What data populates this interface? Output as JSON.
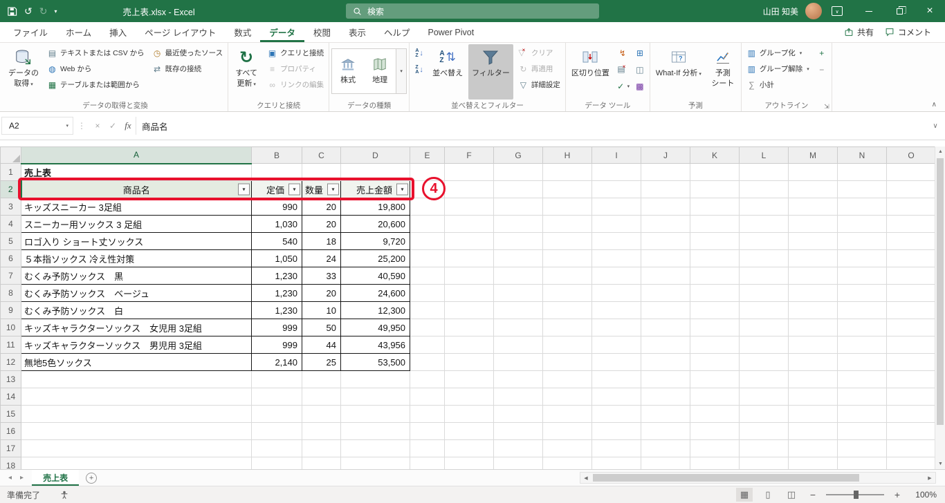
{
  "title_bar": {
    "document_title": "売上表.xlsx - Excel",
    "search_label": "検索",
    "user_name": "山田 知美"
  },
  "tab_row": {
    "tabs": [
      {
        "label": "ファイル",
        "active": false
      },
      {
        "label": "ホーム",
        "active": false
      },
      {
        "label": "挿入",
        "active": false
      },
      {
        "label": "ページ レイアウト",
        "active": false
      },
      {
        "label": "数式",
        "active": false
      },
      {
        "label": "データ",
        "active": true
      },
      {
        "label": "校閲",
        "active": false
      },
      {
        "label": "表示",
        "active": false
      },
      {
        "label": "ヘルプ",
        "active": false
      },
      {
        "label": "Power Pivot",
        "active": false
      }
    ],
    "share": "共有",
    "comments": "コメント"
  },
  "ribbon": {
    "group_labels": [
      "データの取得と変換",
      "クエリと接続",
      "データの種類",
      "並べ替えとフィルター",
      "データ ツール",
      "予測",
      "アウトライン"
    ],
    "get_data_l1": "データの",
    "get_data_l2": "取得",
    "from_text_csv": "テキストまたは CSV から",
    "from_web": "Web から",
    "from_table_range": "テーブルまたは範囲から",
    "recent_sources": "最近使ったソース",
    "existing_connections": "既存の接続",
    "refresh_l1": "すべて",
    "refresh_l2": "更新",
    "queries_connections": "クエリと接続",
    "properties": "プロパティ",
    "edit_links": "リンクの編集",
    "stocks": "株式",
    "geography": "地理",
    "sort": "並べ替え",
    "filter": "フィルター",
    "clear": "クリア",
    "reapply": "再適用",
    "advanced": "詳細設定",
    "text_to_columns": "区切り位置",
    "what_if": "What-If 分析",
    "forecast_l1": "予測",
    "forecast_l2": "シート",
    "group": "グループ化",
    "ungroup": "グループ解除",
    "subtotal": "小計"
  },
  "formula_bar": {
    "name_box": "A2",
    "fx": "fx",
    "value": "商品名"
  },
  "grid": {
    "column_headers": [
      "A",
      "B",
      "C",
      "D",
      "E",
      "F",
      "G",
      "H",
      "I",
      "J",
      "K",
      "L",
      "M",
      "N",
      "O"
    ],
    "row_count": 18,
    "title_cell": "売上表",
    "header_cells": [
      "商品名",
      "定価",
      "数量",
      "売上金額"
    ],
    "data_rows": [
      [
        "キッズスニーカー 3足組",
        "990",
        "20",
        "19,800"
      ],
      [
        "スニーカー用ソックス 3 足組",
        "1,030",
        "20",
        "20,600"
      ],
      [
        "ロゴ入り ショート丈ソックス",
        "540",
        "18",
        "9,720"
      ],
      [
        "５本指ソックス 冷え性対策",
        "1,050",
        "24",
        "25,200"
      ],
      [
        "むくみ予防ソックス　黒",
        "1,230",
        "33",
        "40,590"
      ],
      [
        "むくみ予防ソックス　ベージュ",
        "1,230",
        "20",
        "24,600"
      ],
      [
        "むくみ予防ソックス　白",
        "1,230",
        "10",
        "12,300"
      ],
      [
        "キッズキャラクターソックス　女児用 3足組",
        "999",
        "50",
        "49,950"
      ],
      [
        "キッズキャラクターソックス　男児用 3足組",
        "999",
        "44",
        "43,956"
      ],
      [
        "無地5色ソックス",
        "2,140",
        "25",
        "53,500"
      ]
    ],
    "active_cell": "A2"
  },
  "annotation": {
    "label": "4"
  },
  "sheet_tabs": {
    "active_tab": "売上表"
  },
  "status_bar": {
    "ready": "準備完了",
    "zoom": "100%"
  },
  "colors": {
    "brand_green": "#217346",
    "annotation_red": "#E8112D"
  }
}
